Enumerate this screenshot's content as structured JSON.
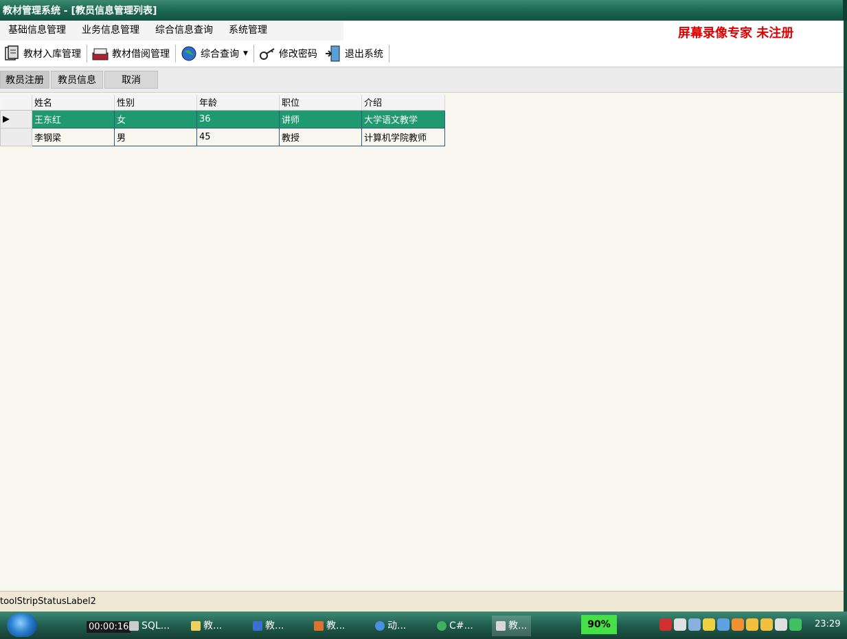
{
  "window": {
    "title": "教材管理系统 - [教员信息管理列表]"
  },
  "menu": [
    "基础信息管理",
    "业务信息管理",
    "综合信息查询",
    "系统管理"
  ],
  "watermark": "屏幕录像专家  未注册",
  "toolbar": [
    {
      "label": "教材入库管理",
      "icon": "book-in-icon"
    },
    {
      "label": "教材借阅管理",
      "icon": "book-borrow-icon"
    },
    {
      "label": "综合查询",
      "icon": "globe-icon"
    },
    {
      "label": "修改密码",
      "icon": "key-icon"
    },
    {
      "label": "退出系统",
      "icon": "exit-door-icon"
    }
  ],
  "subbar": {
    "register": "教员注册",
    "info": "教员信息",
    "cancel": "取消"
  },
  "grid": {
    "columns": [
      "姓名",
      "性别",
      "年龄",
      "职位",
      "介绍"
    ],
    "rows": [
      [
        "王东红",
        "女",
        "36",
        "讲师",
        "大学语文教学"
      ],
      [
        "李钢梁",
        "男",
        "45",
        "教授",
        "计算机学院教师"
      ]
    ]
  },
  "status": {
    "label": "toolStripStatusLabel2"
  },
  "taskbar": {
    "timer": "00:00:16",
    "tasks": [
      "SQL...",
      "教...",
      "教...",
      "教...",
      "动...",
      "C#...",
      "教..."
    ],
    "battery": "90%",
    "clock": "23:29"
  }
}
